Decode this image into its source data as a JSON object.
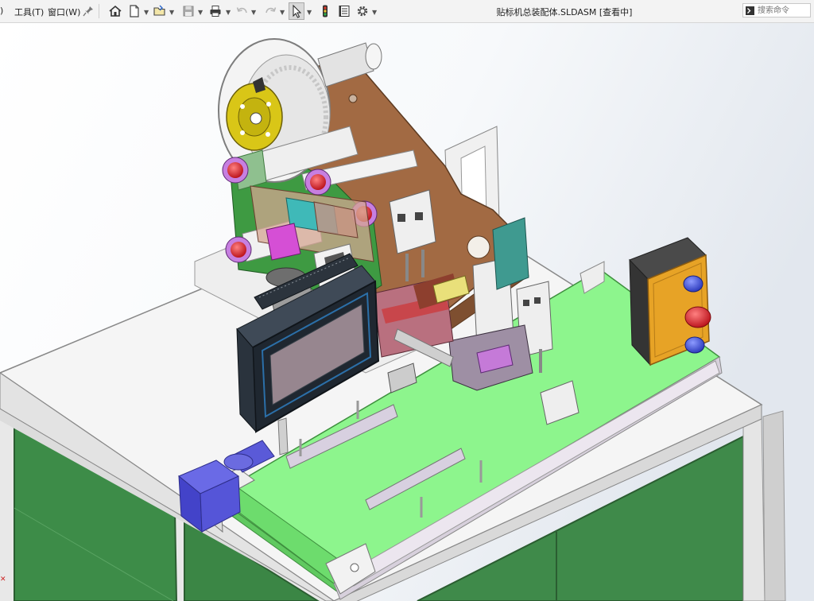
{
  "menu": {
    "partial_left": ")",
    "tools": "工具(T)",
    "window": "窗口(W)"
  },
  "document": {
    "title": "贴标机总装配体.SLDASM [查看中]"
  },
  "search": {
    "placeholder": "搜索命令"
  },
  "colors": {
    "conveyor_belt": "#8df58d",
    "cabinet_panel": "#3f8a4a",
    "frame_white": "#f4f4f4",
    "bracket_brown": "#a26a43",
    "hmi_screen": "#97868f",
    "button_red": "#d8151f",
    "button_blue": "#3f53d9",
    "control_box_yellow": "#e7a326",
    "motor_blue": "#4848d0"
  },
  "toolbar_icons": [
    "pin-icon",
    "home-icon",
    "new-document-icon",
    "open-folder-icon",
    "save-icon",
    "print-icon",
    "undo-icon",
    "redo-icon",
    "select-pointer-icon",
    "traffic-light-icon",
    "file-properties-icon",
    "options-gear-icon"
  ],
  "view_icons": [
    "zoom-to-fit-icon",
    "zoom-area-icon",
    "previous-view-icon",
    "section-view-icon",
    "view-orientation-icon",
    "display-style-icon",
    "hide-show-items-icon",
    "edit-appearance-icon",
    "apply-scene-icon",
    "view-settings-icon"
  ]
}
